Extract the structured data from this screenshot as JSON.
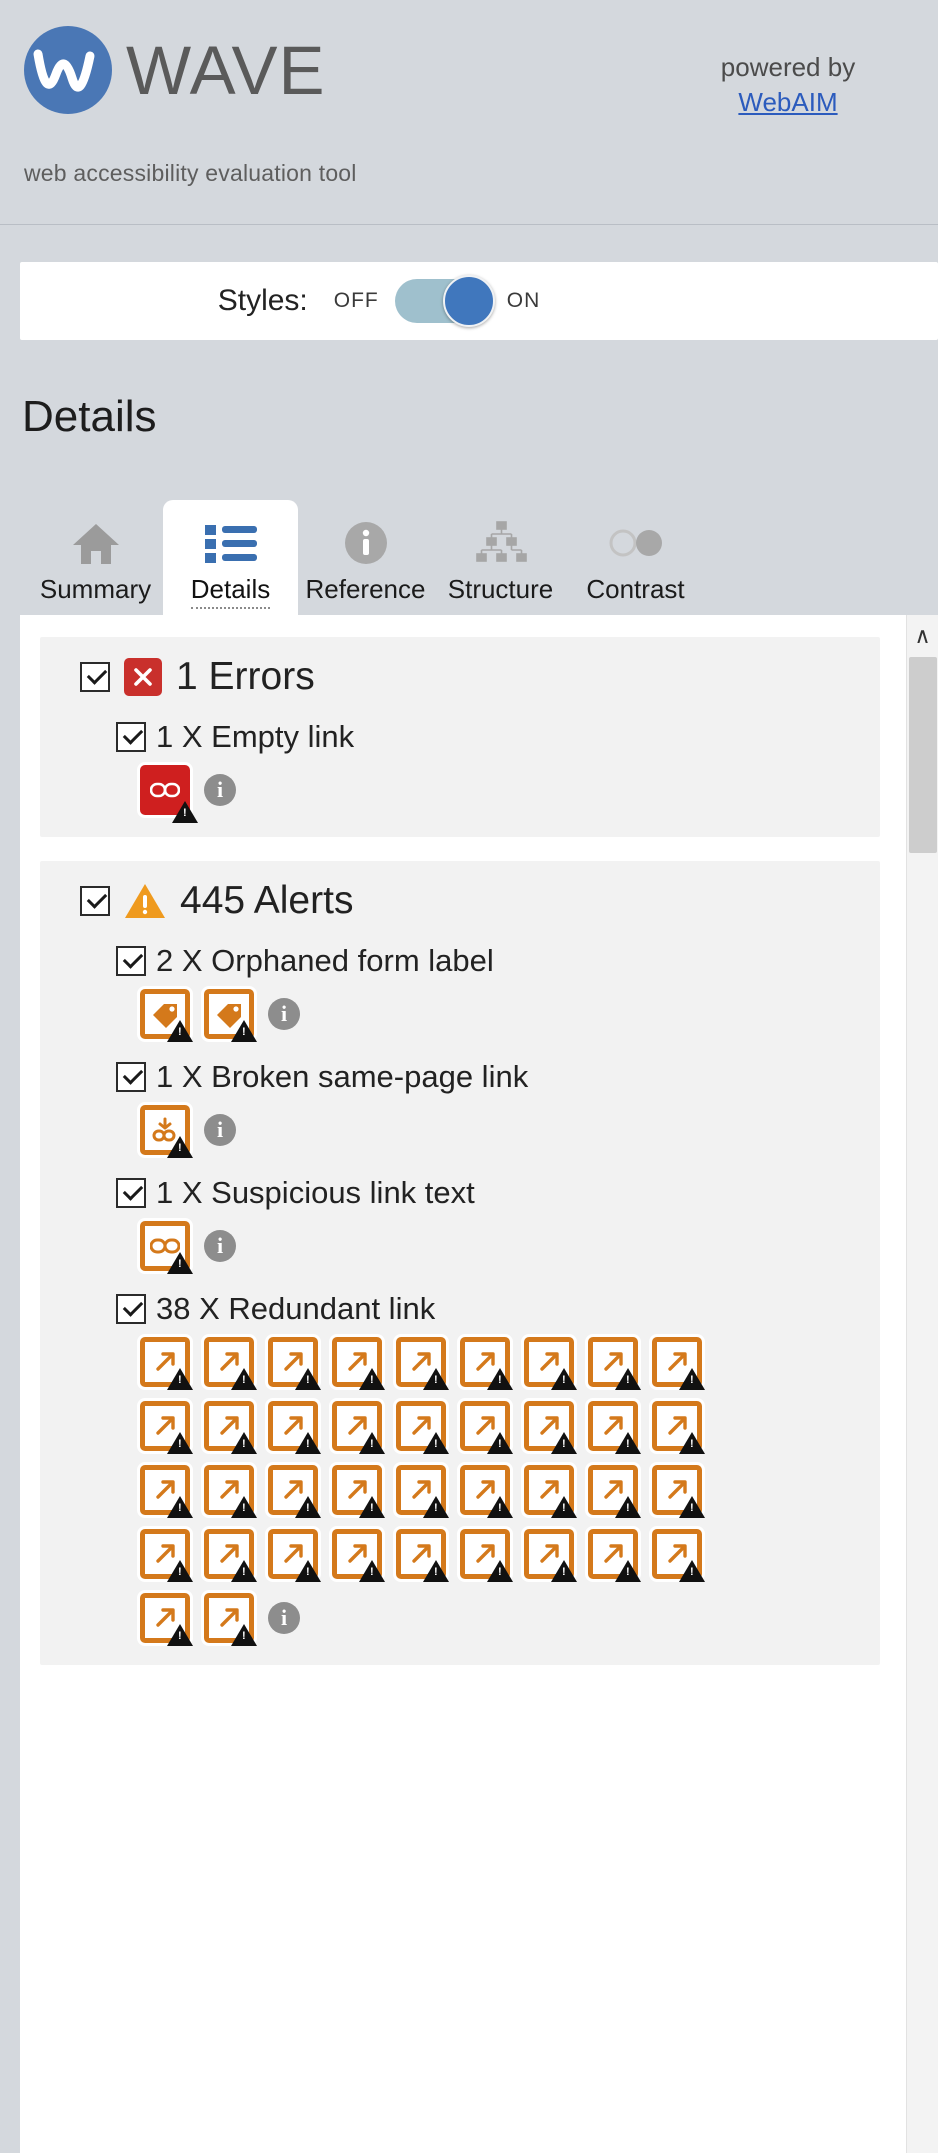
{
  "header": {
    "brand": "WAVE",
    "tagline": "web accessibility evaluation tool",
    "powered_by": "powered by",
    "powered_link": "WebAIM",
    "logo_icon": "wave-circle-logo"
  },
  "styles_bar": {
    "label": "Styles:",
    "off_label": "OFF",
    "on_label": "ON",
    "state": "on",
    "toggle_icon": "toggle-switch"
  },
  "page_title": "Details",
  "tabs": [
    {
      "label": "Summary",
      "icon": "home-icon",
      "active": false
    },
    {
      "label": "Details",
      "icon": "list-icon",
      "active": true
    },
    {
      "label": "Reference",
      "icon": "info-icon",
      "active": false
    },
    {
      "label": "Structure",
      "icon": "hierarchy-icon",
      "active": false
    },
    {
      "label": "Contrast",
      "icon": "two-circles-icon",
      "active": false
    }
  ],
  "groups": [
    {
      "id": "errors",
      "title": "1 Errors",
      "badge_icon": "red-x-icon",
      "badge_color": "#c9302c",
      "checked": true,
      "items": [
        {
          "label": "1 X Empty link",
          "checked": true,
          "icon_type": "red",
          "icon_name": "empty-link-icon",
          "icon_count": 1,
          "info_icon": "info-icon"
        }
      ]
    },
    {
      "id": "alerts",
      "title": "445 Alerts",
      "badge_icon": "orange-warning-triangle-icon",
      "badge_color": "#ef9a1e",
      "checked": true,
      "items": [
        {
          "label": "2 X Orphaned form label",
          "checked": true,
          "icon_type": "orange",
          "icon_name": "orphaned-form-label-icon",
          "icon_glyph": "tag",
          "icon_count": 2,
          "info_icon": "info-icon"
        },
        {
          "label": "1 X Broken same-page link",
          "checked": true,
          "icon_type": "orange",
          "icon_name": "broken-same-page-link-icon",
          "icon_glyph": "brokenlink",
          "icon_count": 1,
          "info_icon": "info-icon"
        },
        {
          "label": "1 X Suspicious link text",
          "checked": true,
          "icon_type": "orange",
          "icon_name": "suspicious-link-text-icon",
          "icon_glyph": "link",
          "icon_count": 1,
          "info_icon": "info-icon"
        },
        {
          "label": "38 X Redundant link",
          "checked": true,
          "icon_type": "orange",
          "icon_name": "redundant-link-icon",
          "icon_glyph": "arrow",
          "icon_count": 38,
          "info_icon": "info-icon"
        }
      ]
    }
  ],
  "scrollbar": {
    "up_arrow": "∧",
    "name": "panel-scrollbar"
  }
}
